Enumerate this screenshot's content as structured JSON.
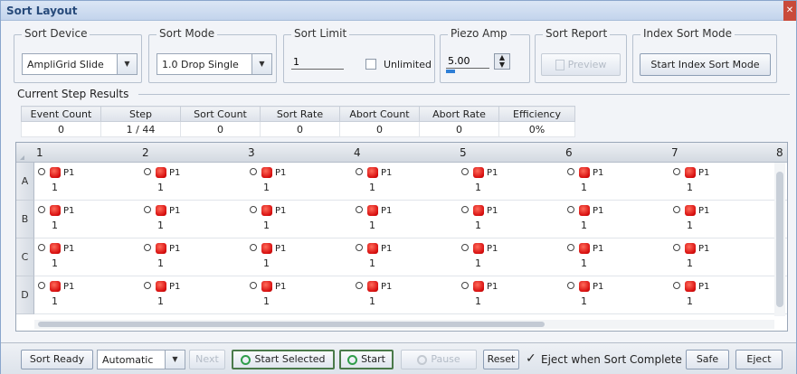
{
  "window": {
    "title": "Sort Layout",
    "close_glyph": "✕"
  },
  "controls": {
    "sort_device": {
      "label": "Sort Device",
      "value": "AmpliGrid Slide"
    },
    "sort_mode": {
      "label": "Sort Mode",
      "value": "1.0 Drop Single"
    },
    "sort_limit": {
      "label": "Sort Limit",
      "value": "1",
      "unlimited_label": "Unlimited",
      "unlimited_checked": false
    },
    "piezo_amp": {
      "label": "Piezo Amp",
      "value": "5.00"
    },
    "sort_report": {
      "label": "Sort Report",
      "preview_label": "Preview"
    },
    "index_sort_mode": {
      "label": "Index Sort Mode",
      "button_label": "Start Index Sort Mode"
    }
  },
  "results": {
    "label": "Current Step Results",
    "headers": [
      "Event Count",
      "Step",
      "Sort Count",
      "Sort Rate",
      "Abort Count",
      "Abort Rate",
      "Efficiency"
    ],
    "values": [
      "0",
      "1 / 44",
      "0",
      "0",
      "0",
      "0",
      "0%"
    ]
  },
  "grid": {
    "columns": [
      "1",
      "2",
      "3",
      "4",
      "5",
      "6",
      "7",
      "8"
    ],
    "rows": [
      {
        "label": "A",
        "cells": [
          {
            "p": "P1",
            "n": "1"
          },
          {
            "p": "P1",
            "n": "1"
          },
          {
            "p": "P1",
            "n": "1"
          },
          {
            "p": "P1",
            "n": "1"
          },
          {
            "p": "P1",
            "n": "1"
          },
          {
            "p": "P1",
            "n": "1"
          },
          {
            "p": "P1",
            "n": "1"
          }
        ]
      },
      {
        "label": "B",
        "cells": [
          {
            "p": "P1",
            "n": "1"
          },
          {
            "p": "P1",
            "n": "1"
          },
          {
            "p": "P1",
            "n": "1"
          },
          {
            "p": "P1",
            "n": "1"
          },
          {
            "p": "P1",
            "n": "1"
          },
          {
            "p": "P1",
            "n": "1"
          },
          {
            "p": "P1",
            "n": "1"
          }
        ]
      },
      {
        "label": "C",
        "cells": [
          {
            "p": "P1",
            "n": "1"
          },
          {
            "p": "P1",
            "n": "1"
          },
          {
            "p": "P1",
            "n": "1"
          },
          {
            "p": "P1",
            "n": "1"
          },
          {
            "p": "P1",
            "n": "1"
          },
          {
            "p": "P1",
            "n": "1"
          },
          {
            "p": "P1",
            "n": "1"
          }
        ]
      },
      {
        "label": "D",
        "cells": [
          {
            "p": "P1",
            "n": "1"
          },
          {
            "p": "P1",
            "n": "1"
          },
          {
            "p": "P1",
            "n": "1"
          },
          {
            "p": "P1",
            "n": "1"
          },
          {
            "p": "P1",
            "n": "1"
          },
          {
            "p": "P1",
            "n": "1"
          },
          {
            "p": "P1",
            "n": "1"
          }
        ]
      }
    ],
    "sorted_color": "#d81010"
  },
  "bottom": {
    "sort_ready": "Sort Ready",
    "mode_value": "Automatic",
    "next": "Next",
    "start_selected": "Start Selected",
    "start": "Start",
    "pause": "Pause",
    "reset": "Reset",
    "eject_when_complete": "Eject when Sort Complete",
    "eject_checked": true,
    "safe": "Safe",
    "eject": "Eject"
  }
}
